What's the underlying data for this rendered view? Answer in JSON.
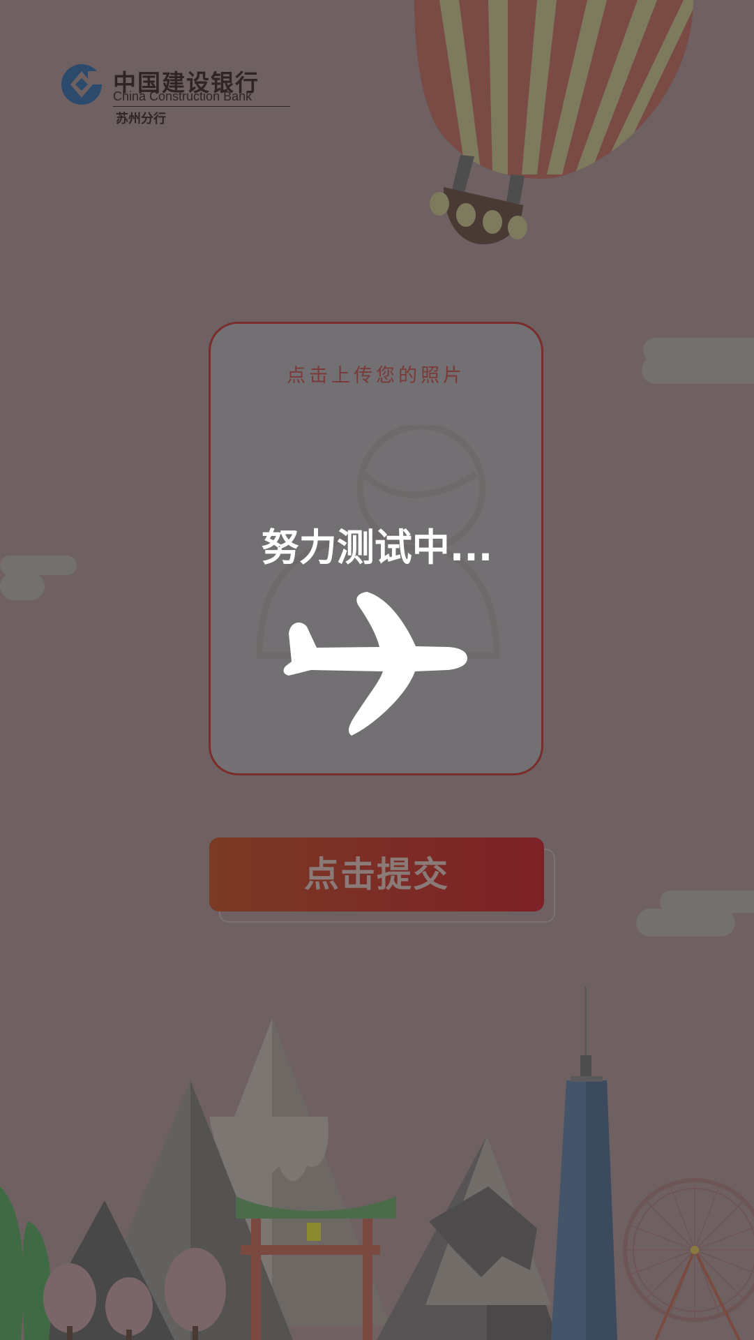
{
  "logo": {
    "name_cn": "中国建设银行",
    "name_en": "China Construction Bank",
    "branch": "苏州分行"
  },
  "upload": {
    "prompt": "点击上传您的照片"
  },
  "loading": {
    "text": "努力测试中..."
  },
  "submit": {
    "label": "点击提交"
  },
  "colors": {
    "overlay": "#6f6062",
    "card_border": "#7b2c2c",
    "button_start": "#7a3a24",
    "button_end": "#7d2127"
  },
  "icons": {
    "logo": "ccb-logo-icon",
    "avatar": "user-avatar-icon",
    "loading": "airplane-icon"
  }
}
